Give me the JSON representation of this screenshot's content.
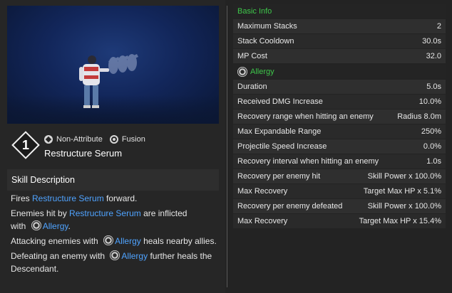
{
  "skill": {
    "level": "1",
    "tags": [
      "Non-Attribute",
      "Fusion"
    ],
    "name": "Restructure Serum"
  },
  "description": {
    "heading": "Skill Description",
    "lines": {
      "l1a": "Fires ",
      "l1b": "Restructure Serum",
      "l1c": " forward.",
      "l2a": "Enemies hit by ",
      "l2b": "Restructure Serum",
      "l2c": " are inflicted",
      "l2d": "with ",
      "l2e": "Allergy",
      "l2f": ".",
      "l3a": "Attacking enemies with ",
      "l3b": "Allergy",
      "l3c": " heals nearby allies.",
      "l4a": "Defeating an enemy with ",
      "l4b": "Allergy",
      "l4c": " further heals the Descendant."
    }
  },
  "basic_info": {
    "title": "Basic Info",
    "rows": [
      {
        "k": "Maximum Stacks",
        "v": "2"
      },
      {
        "k": "Stack Cooldown",
        "v": "30.0s"
      },
      {
        "k": "MP Cost",
        "v": "32.0"
      }
    ]
  },
  "allergy": {
    "title": "Allergy",
    "rows": [
      {
        "k": "Duration",
        "v": "5.0s"
      },
      {
        "k": "Received DMG Increase",
        "v": "10.0%"
      },
      {
        "k": "Recovery range when hitting an enemy",
        "v": "Radius 8.0m"
      },
      {
        "k": "Max Expandable Range",
        "v": "250%"
      },
      {
        "k": "Projectile Speed Increase",
        "v": "0.0%"
      },
      {
        "k": "Recovery interval when hitting an enemy",
        "v": "1.0s"
      },
      {
        "k": "Recovery per enemy hit",
        "v": "Skill Power x 100.0%"
      },
      {
        "k": "Max Recovery",
        "v": "Target Max HP x 5.1%"
      },
      {
        "k": "Recovery per enemy defeated",
        "v": "Skill Power x 100.0%"
      },
      {
        "k": "Max Recovery",
        "v": "Target Max HP x 15.4%"
      }
    ]
  }
}
